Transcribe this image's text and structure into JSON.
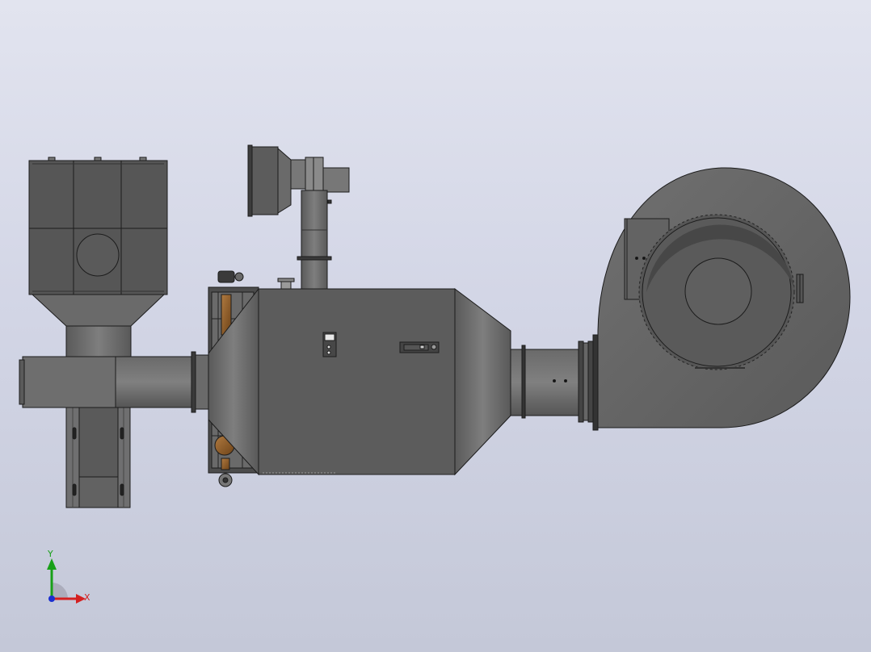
{
  "triad": {
    "x_label": "X",
    "y_label": "Y",
    "colors": {
      "x": "#d42020",
      "y": "#18a018",
      "z": "#1a2fd0"
    }
  },
  "colors": {
    "background_top": "#e2e4ef",
    "background_bottom": "#c4c8d8",
    "body": "#5c5c5c",
    "body_dark": "#4a4a4a",
    "body_light": "#767676",
    "edge": "#1c1c1c",
    "bronze": "#8a5a2a"
  },
  "model": {
    "components": [
      "filter-housing",
      "hopper",
      "inlet-duct",
      "support-stand",
      "exhaust-hood",
      "vertical-duct",
      "valve-rack",
      "main-vessel",
      "outlet-cone",
      "connecting-duct",
      "centrifugal-fan"
    ]
  }
}
